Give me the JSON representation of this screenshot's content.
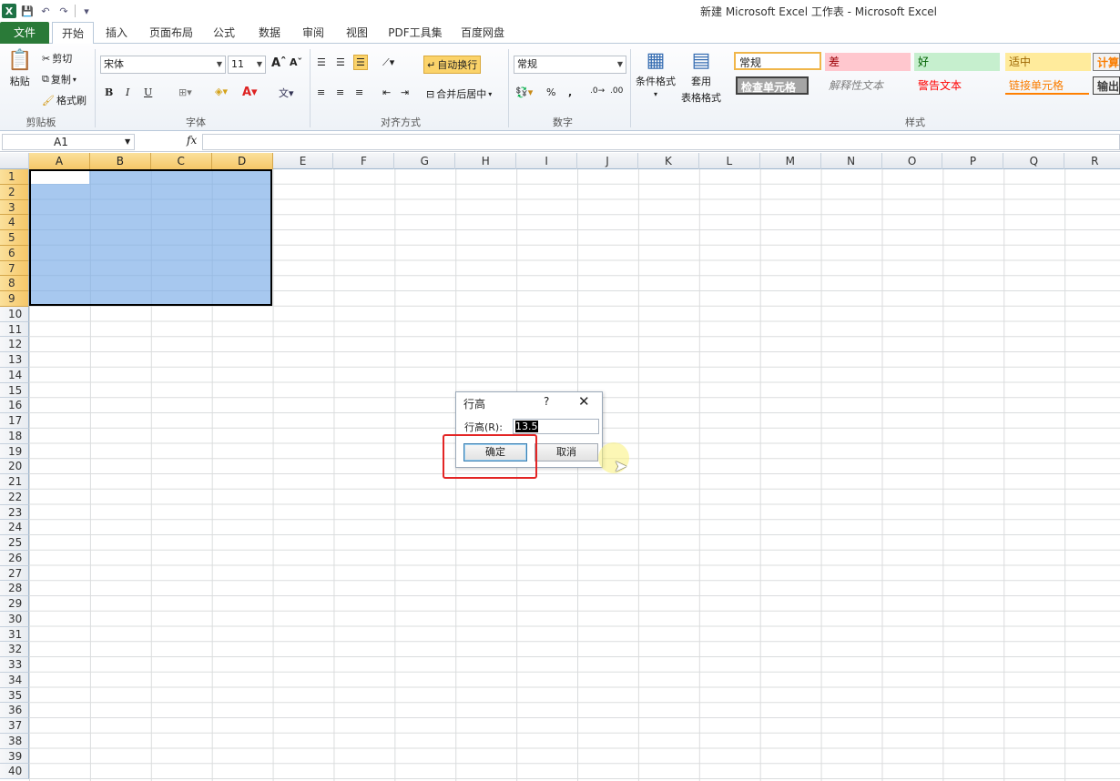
{
  "window": {
    "title": "新建 Microsoft Excel 工作表 - Microsoft Excel"
  },
  "qat": {
    "logo": "X",
    "save": "💾",
    "undo": "↶",
    "redo": "↷",
    "customize": "▾"
  },
  "tabs": [
    "文件",
    "开始",
    "插入",
    "页面布局",
    "公式",
    "数据",
    "审阅",
    "视图",
    "PDF工具集",
    "百度网盘"
  ],
  "ribbon": {
    "clipboard": {
      "paste": "粘贴",
      "cut": "剪切",
      "copy": "复制",
      "format_painter": "格式刷",
      "group": "剪贴板"
    },
    "font": {
      "name": "宋体",
      "size": "11",
      "bold": "B",
      "italic": "I",
      "underline": "U",
      "group": "字体"
    },
    "alignment": {
      "wrap": "自动换行",
      "merge": "合并后居中",
      "group": "对齐方式"
    },
    "number": {
      "format": "常规",
      "percent": "%",
      "comma": ",",
      "group": "数字"
    },
    "styles": {
      "conditional": "条件格式",
      "table_a": "套用",
      "table_b": "表格格式",
      "cells": [
        "常规",
        "差",
        "好",
        "适中",
        "计算",
        "检查单元格",
        "解释性文本",
        "警告文本",
        "链接单元格",
        "输出"
      ],
      "group": "样式"
    }
  },
  "formula_bar": {
    "name_box": "A1",
    "fx": "fx",
    "value": ""
  },
  "columns": [
    "A",
    "B",
    "C",
    "D",
    "E",
    "F",
    "G",
    "H",
    "I",
    "J",
    "K",
    "L",
    "M",
    "N",
    "O",
    "P",
    "Q",
    "R"
  ],
  "rows": [
    "1",
    "2",
    "3",
    "4",
    "5",
    "6",
    "7",
    "8",
    "9",
    "10",
    "11",
    "12",
    "13",
    "14",
    "15",
    "16",
    "17",
    "18",
    "19",
    "20",
    "21",
    "22",
    "23",
    "24",
    "25",
    "26",
    "27",
    "28",
    "29",
    "30",
    "31",
    "32",
    "33",
    "34",
    "35",
    "36",
    "37",
    "38",
    "39",
    "40"
  ],
  "dialog": {
    "title": "行高",
    "help": "?",
    "close": "✕",
    "label": "行高(R):",
    "value": "13.5",
    "ok": "确定",
    "cancel": "取消"
  }
}
